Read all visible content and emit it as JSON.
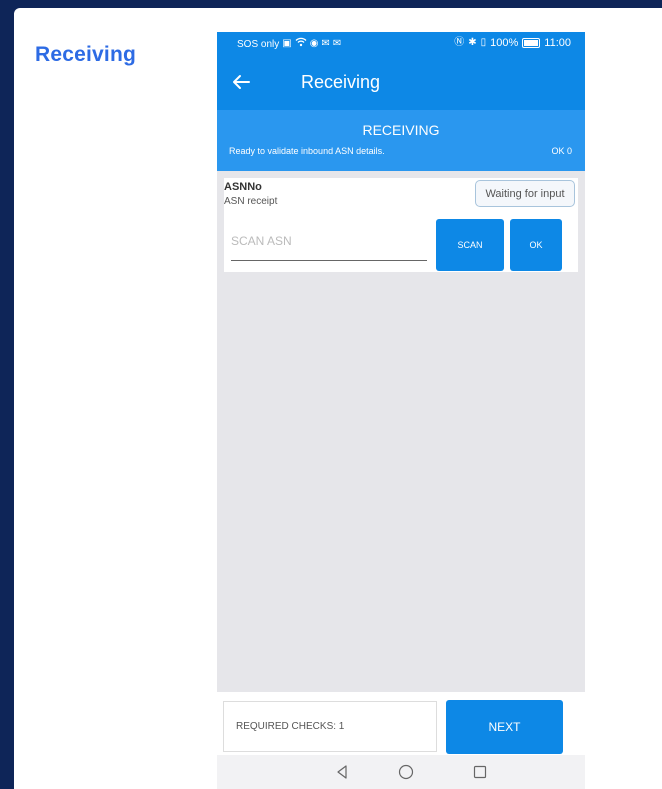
{
  "page": {
    "title": "Receiving"
  },
  "status_bar": {
    "carrier": "SOS only",
    "battery": "100%",
    "time": "11:00"
  },
  "app_bar": {
    "title": "Receiving"
  },
  "header": {
    "title": "RECEIVING",
    "subtitle": "Ready to validate inbound ASN details.",
    "ok_count": "OK 0"
  },
  "asn_field": {
    "label": "ASNNo",
    "description": "ASN receipt",
    "status": "Waiting for input",
    "placeholder": "SCAN ASN",
    "scan_label": "SCAN",
    "ok_label": "OK"
  },
  "footer": {
    "required_checks": "REQUIRED CHECKS: 1",
    "next_label": "NEXT"
  },
  "colors": {
    "background": "#0e2558",
    "primary": "#0d88e6",
    "header_band": "#2a97ef",
    "title_accent": "#2d6be4"
  }
}
